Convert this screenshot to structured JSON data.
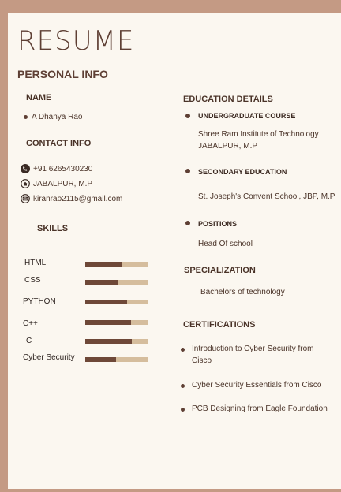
{
  "resume_title": "RESUME",
  "personal": {
    "heading": "PERSONAL INFO",
    "name_label": "NAME",
    "name": "A Dhanya Rao"
  },
  "contact": {
    "heading": "CONTACT INFO",
    "phone": "+91 6265430230",
    "location": "JABALPUR, M.P",
    "email": "kiranrao2115@gmail.com"
  },
  "skills": {
    "heading": "SKILLS",
    "items": [
      {
        "label": "HTML",
        "level": 0.58
      },
      {
        "label": "CSS",
        "level": 0.53
      },
      {
        "label": "PYTHON",
        "level": 0.66
      },
      {
        "label": "C++",
        "level": 0.72
      },
      {
        "label": "C",
        "level": 0.74
      },
      {
        "label": "Cyber Security",
        "level": 0.49
      }
    ]
  },
  "education": {
    "heading": "EDUCATION DETAILS",
    "items": [
      {
        "title": "UNDERGRADUATE COURSE",
        "line1": "Shree Ram Institute of Technology",
        "line2": "JABALPUR, M.P"
      },
      {
        "title": "SECONDARY EDUCATION",
        "line1": "St. Joseph's Convent School, JBP, M.P",
        "line2": ""
      },
      {
        "title": "POSITIONS",
        "line1": "Head Of school",
        "line2": ""
      }
    ]
  },
  "specialization": {
    "heading": "SPECIALIZATION",
    "value": "Bachelors of technology"
  },
  "certifications": {
    "heading": "CERTIFICATIONS",
    "items": [
      {
        "line1": "Introduction to Cyber Security from",
        "line2": "Cisco"
      },
      {
        "line1": "Cyber Security Essentials from Cisco",
        "line2": ""
      },
      {
        "line1": "PCB Designing from Eagle Foundation",
        "line2": ""
      }
    ]
  },
  "colors": {
    "border": "#c49a84",
    "paper": "#fbf7f0",
    "accent": "#5e3f34",
    "bar_fill": "#6e4838",
    "bar_track": "#d5bd9d"
  },
  "icons": [
    "phone-icon",
    "home-icon",
    "email-icon",
    "bullet-dot-icon"
  ]
}
